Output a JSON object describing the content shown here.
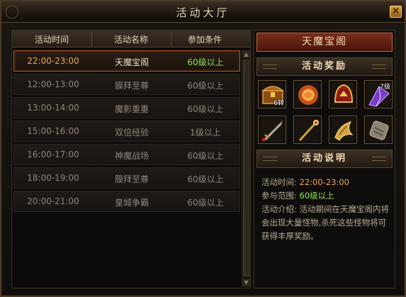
{
  "window": {
    "title": "活动大厅",
    "close_label": "✕"
  },
  "table": {
    "headers": [
      "活动时间",
      "活动名称",
      "参加条件"
    ],
    "rows": [
      {
        "time": "22:00-23:00",
        "name": "天魔宝阁",
        "cond": "60级以上"
      },
      {
        "time": "12:00-13:00",
        "name": "膜拜至尊",
        "cond": "60级以上"
      },
      {
        "time": "13:00-14:00",
        "name": "魔影重重",
        "cond": "60级以上"
      },
      {
        "time": "15:00-16:00",
        "name": "双倍经验",
        "cond": "1级以上"
      },
      {
        "time": "16:00-17:00",
        "name": "神魔战场",
        "cond": "60级以上"
      },
      {
        "time": "18:00-19:00",
        "name": "膜拜至尊",
        "cond": "60级以上"
      },
      {
        "time": "20:00-21:00",
        "name": "皇城争霸",
        "cond": "60级以上"
      }
    ],
    "selected_index": 0
  },
  "detail": {
    "event_name": "天魔宝阁",
    "rewards_title": "活动奖励",
    "rewards": [
      {
        "icon": "treasure-chest-icon",
        "count": "6转"
      },
      {
        "icon": "orange-orb-icon"
      },
      {
        "icon": "golden-helmet-icon"
      },
      {
        "icon": "purple-crystal-icon",
        "level": "7级"
      },
      {
        "icon": "sword-icon"
      },
      {
        "icon": "staff-icon"
      },
      {
        "icon": "golden-claw-icon"
      },
      {
        "icon": "stone-tablet-icon"
      }
    ],
    "desc_title": "活动说明",
    "time_label": "活动时间:",
    "time_value": "22:00-23:00",
    "range_label": "参与范围:",
    "range_value": "60级以上",
    "intro_label": "活动介绍:",
    "intro_text": "活动期间在天魔宝阁内将会出现大量怪物,杀死这些怪物将可获得丰厚奖励。"
  },
  "colors": {
    "selected_time": "#e7a45c",
    "level_green": "#8fe35b",
    "title_red": "#7a2c1c"
  }
}
